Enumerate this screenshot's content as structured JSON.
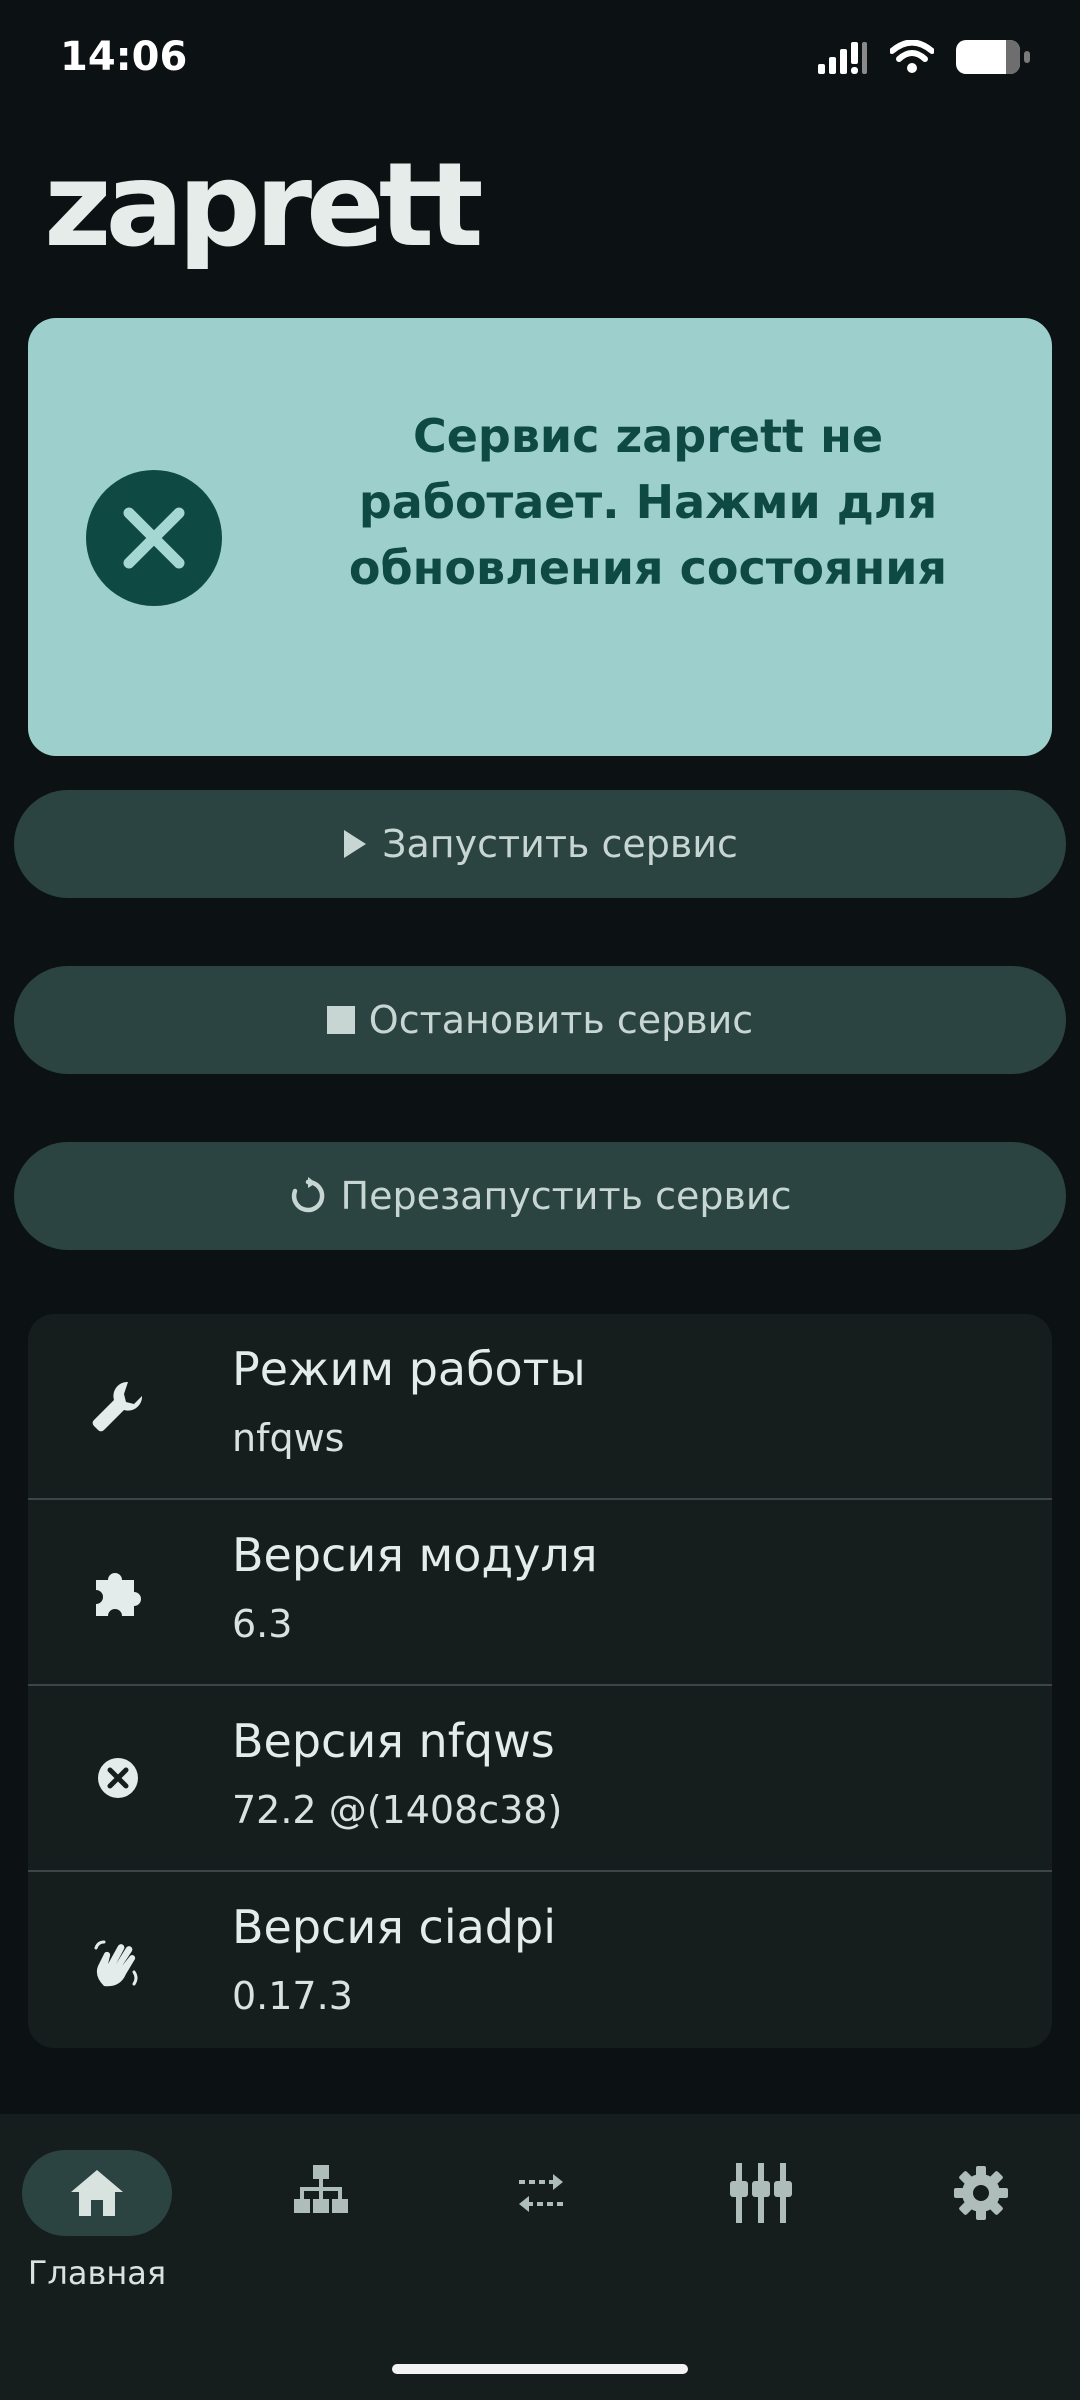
{
  "status_bar": {
    "time": "14:06"
  },
  "app": {
    "title": "zaprett"
  },
  "status_card": {
    "message": "Сервис zaprett не работает. Нажми для обновления состояния"
  },
  "actions": {
    "start_label": "Запустить сервис",
    "stop_label": "Остановить сервис",
    "restart_label": "Перезапустить сервис"
  },
  "info": [
    {
      "label": "Режим работы",
      "value": "nfqws",
      "icon": "wrench-icon"
    },
    {
      "label": "Версия модуля",
      "value": "6.3",
      "icon": "puzzle-icon"
    },
    {
      "label": "Версия nfqws",
      "value": "72.2 @(1408c38)",
      "icon": "cancel-circle-icon"
    },
    {
      "label": "Версия ciadpi",
      "value": "0.17.3",
      "icon": "waving-hand-icon"
    }
  ],
  "bottom_nav": {
    "home_label": "Главная",
    "items": [
      "home-icon",
      "sitemap-icon",
      "swap-arrows-icon",
      "equalizer-icon",
      "gear-icon"
    ]
  },
  "colors": {
    "background": "#0c1213",
    "status_card": "#9dd0cc",
    "status_text": "#0f4944",
    "button": "#2b4441",
    "card": "#151d1d"
  }
}
